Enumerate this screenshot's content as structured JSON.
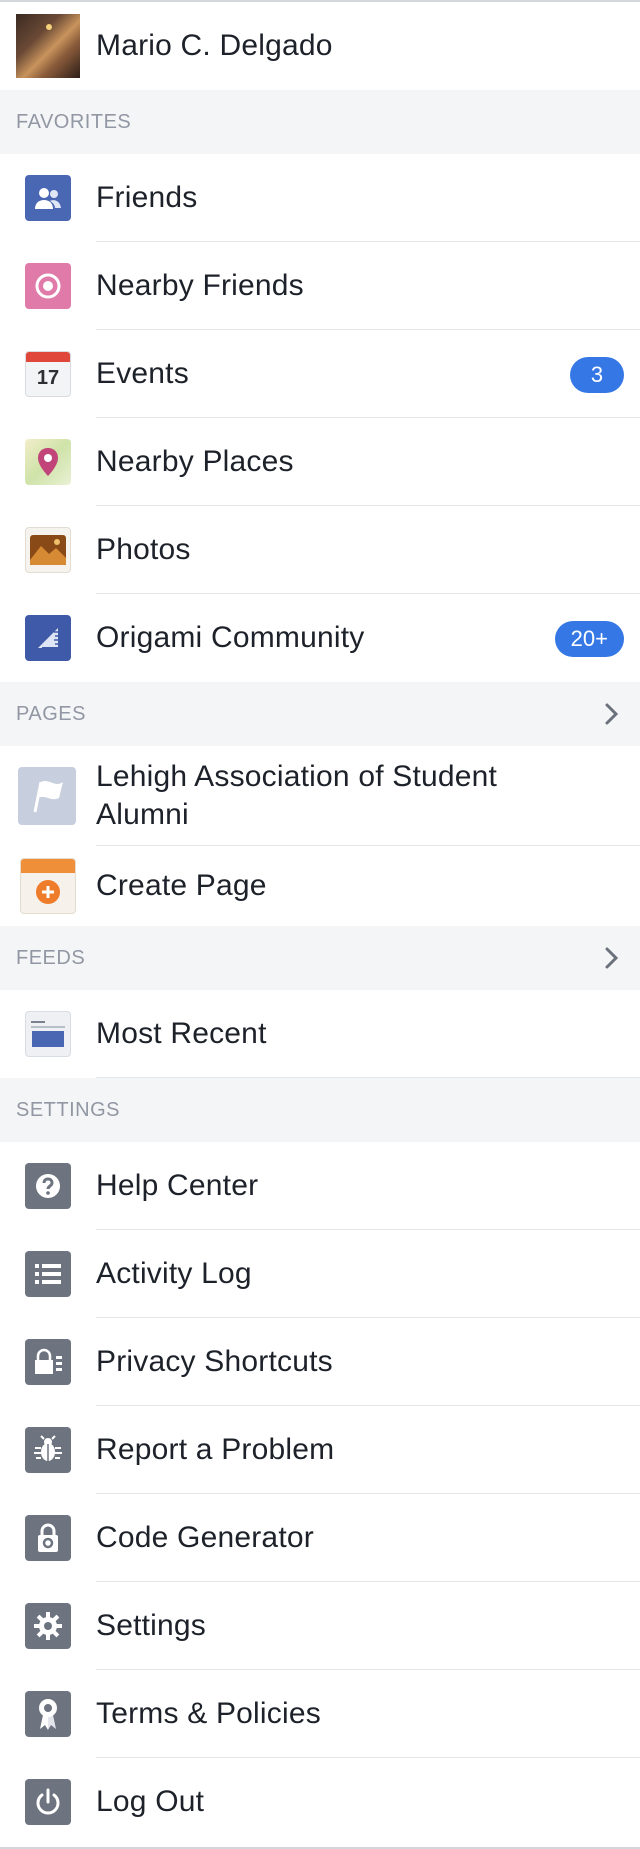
{
  "profile": {
    "name": "Mario C. Delgado"
  },
  "sections": {
    "favorites": "FAVORITES",
    "pages": "PAGES",
    "feeds": "FEEDS",
    "settings": "SETTINGS"
  },
  "favorites": [
    {
      "label": "Friends",
      "icon": "friends-icon"
    },
    {
      "label": "Nearby Friends",
      "icon": "nearby-friends-icon"
    },
    {
      "label": "Events",
      "icon": "calendar-icon",
      "calendar_day": "17",
      "badge": "3"
    },
    {
      "label": "Nearby Places",
      "icon": "map-pin-icon"
    },
    {
      "label": "Photos",
      "icon": "photo-icon"
    },
    {
      "label": "Origami Community",
      "icon": "group-icon",
      "badge": "20+"
    }
  ],
  "pages": [
    {
      "label": "Lehigh Association of Student Alumni",
      "icon": "flag-icon"
    },
    {
      "label": "Create Page",
      "icon": "create-page-icon"
    }
  ],
  "feeds": [
    {
      "label": "Most Recent",
      "icon": "news-feed-icon"
    }
  ],
  "settings": [
    {
      "label": "Help Center",
      "icon": "question-icon"
    },
    {
      "label": "Activity Log",
      "icon": "list-icon"
    },
    {
      "label": "Privacy Shortcuts",
      "icon": "lock-icon"
    },
    {
      "label": "Report a Problem",
      "icon": "bug-icon"
    },
    {
      "label": "Code Generator",
      "icon": "code-lock-icon"
    },
    {
      "label": "Settings",
      "icon": "gear-icon"
    },
    {
      "label": "Terms & Policies",
      "icon": "ribbon-icon"
    },
    {
      "label": "Log Out",
      "icon": "power-icon"
    }
  ],
  "colors": {
    "badge": "#3578e5",
    "section_bg": "#f4f5f7",
    "section_text": "#9197a3",
    "separator": "#e5e6e9",
    "settings_icon": "#6d7480"
  }
}
